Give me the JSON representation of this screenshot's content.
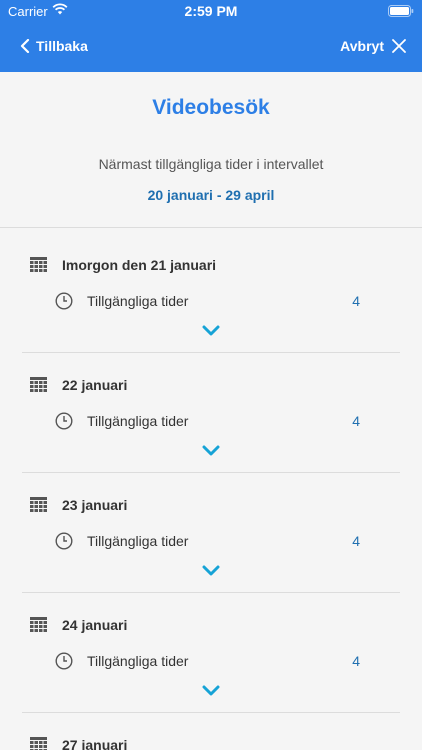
{
  "status_bar": {
    "carrier": "Carrier",
    "time": "2:59 PM"
  },
  "nav": {
    "back_label": "Tillbaka",
    "cancel_label": "Avbryt"
  },
  "main": {
    "title": "Videobesök",
    "subtitle": "Närmast tillgängliga tider i intervallet",
    "date_range": "20 januari - 29 april"
  },
  "days": [
    {
      "title": "Imorgon den 21 januari",
      "slots_label": "Tillgängliga tider",
      "slots_count": "4"
    },
    {
      "title": "22 januari",
      "slots_label": "Tillgängliga tider",
      "slots_count": "4"
    },
    {
      "title": "23 januari",
      "slots_label": "Tillgängliga tider",
      "slots_count": "4"
    },
    {
      "title": "24 januari",
      "slots_label": "Tillgängliga tider",
      "slots_count": "4"
    },
    {
      "title": "27 januari"
    }
  ],
  "colors": {
    "accent": "#2d7fe6",
    "link": "#1f6fb0",
    "background": "#f5f5f5"
  }
}
